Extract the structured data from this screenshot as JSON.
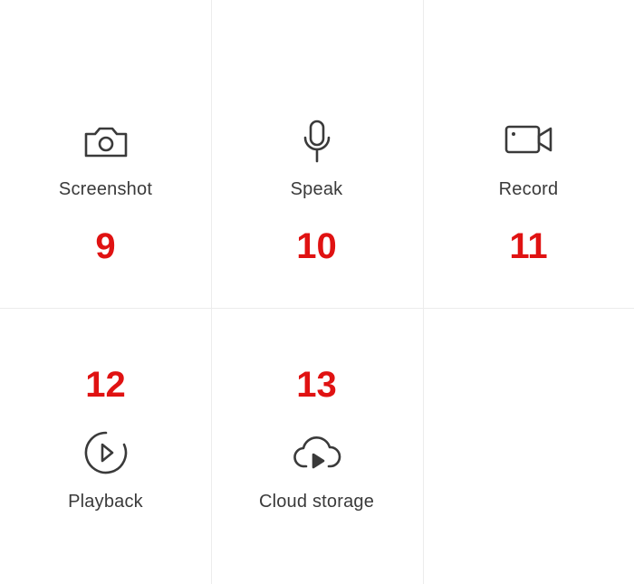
{
  "items": [
    {
      "label": "Screenshot",
      "icon": "camera-icon",
      "annotation": "9"
    },
    {
      "label": "Speak",
      "icon": "microphone-icon",
      "annotation": "10"
    },
    {
      "label": "Record",
      "icon": "video-camera-icon",
      "annotation": "11"
    },
    {
      "label": "Playback",
      "icon": "playback-icon",
      "annotation": "12"
    },
    {
      "label": "Cloud storage",
      "icon": "cloud-play-icon",
      "annotation": "13"
    }
  ],
  "colors": {
    "icon_stroke": "#3a3a3a",
    "label_text": "#3a3a3a",
    "annotation_red": "#e01212",
    "divider": "#ececec"
  }
}
